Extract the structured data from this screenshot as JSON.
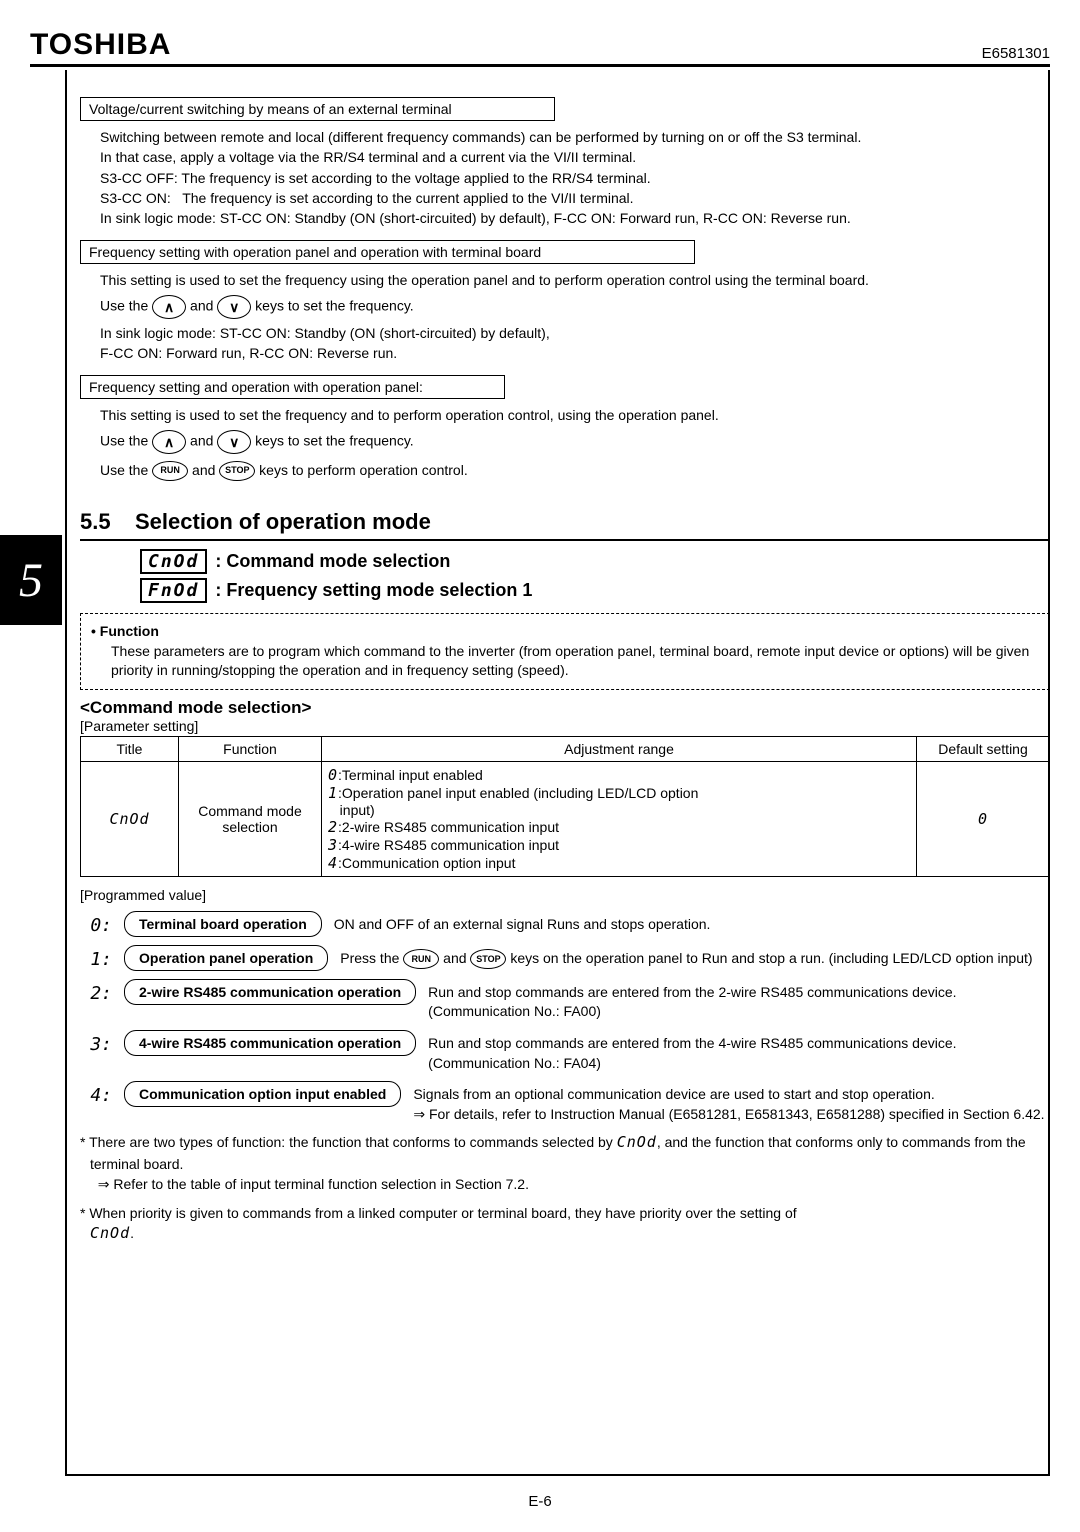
{
  "brand": "TOSHIBA",
  "doc_number": "E6581301",
  "block1": {
    "title": "Voltage/current switching by means of an external terminal",
    "lines": [
      "Switching between remote and local (different frequency commands) can be performed by turning on or off the S3 terminal.",
      "In that case, apply a voltage via the RR/S4 terminal and a current via the VI/II terminal.",
      "S3-CC OFF: The frequency is set according to the voltage applied to the RR/S4 terminal.",
      "S3-CC ON:   The frequency is set according to the current applied to the VI/II terminal.",
      "In sink logic mode: ST-CC ON: Standby (ON (short-circuited) by default), F-CC ON: Forward run, R-CC ON: Reverse run."
    ]
  },
  "block2": {
    "title": "Frequency setting with operation panel and operation with terminal board",
    "lines1": "This setting is used to set the frequency using the operation panel and to perform operation control using the terminal board.",
    "use_the": "Use the",
    "and": "and",
    "keys_freq": "keys to set the frequency.",
    "lines2": "In sink logic mode: ST-CC ON: Standby (ON (short-circuited) by default),",
    "lines3": "F-CC ON: Forward run, R-CC ON: Reverse run."
  },
  "block3": {
    "title": "Frequency setting and operation with operation panel:",
    "line1": "This setting is used to set the frequency and to perform operation control, using the operation panel.",
    "use_the": "Use the",
    "and": "and",
    "keys_freq": "keys to set the frequency.",
    "keys_op": "keys to perform operation control."
  },
  "section": {
    "num": "5.5",
    "title": "Selection of operation mode"
  },
  "chapter_tab": "5",
  "sub": {
    "p1_code": "CnOd",
    "p1_label": ": Command mode selection",
    "p2_code": "FnOd",
    "p2_label": ": Frequency setting mode selection 1"
  },
  "func_box": {
    "heading": "• Function",
    "text": "These parameters are to program which command to the inverter (from operation panel, terminal board, remote input device or options) will be given priority in running/stopping the operation and in frequency setting (speed)."
  },
  "cmd_mode_head": "<Command mode selection>",
  "param_label": "[Parameter setting]",
  "table": {
    "headers": {
      "title": "Title",
      "func": "Function",
      "range": "Adjustment range",
      "def": "Default setting"
    },
    "row": {
      "title": "CnOd",
      "func": "Command mode selection",
      "range_lines": [
        "0:Terminal input enabled",
        "1:Operation panel input enabled (including LED/LCD option input)",
        "2:2-wire RS485 communication input",
        "3:4-wire RS485 communication input",
        "4:Communication option input"
      ],
      "def": "0"
    }
  },
  "prog_label": "[Programmed value]",
  "key_labels": {
    "up": "∧",
    "down": "∨",
    "run": "RUN",
    "stop": "STOP"
  },
  "pv": [
    {
      "num": "0:",
      "pill": "Terminal board operation",
      "text": "ON and OFF of an external signal Runs and stops operation."
    },
    {
      "num": "1:",
      "pill": "Operation panel operation",
      "text_a": "Press the",
      "text_b": "and",
      "text_c": "keys on the operation panel to Run and stop a run. (including LED/LCD option input)"
    },
    {
      "num": "2:",
      "pill": "2-wire RS485 communication operation",
      "text": "Run and stop commands are entered from the 2-wire RS485 communications device. (Communication No.: FA00)"
    },
    {
      "num": "3:",
      "pill": "4-wire RS485 communication operation",
      "text": "Run and stop commands are entered from the 4-wire RS485 communications device. (Communication No.: FA04)"
    },
    {
      "num": "4:",
      "pill": "Communication option input enabled",
      "text": "Signals from an optional communication device are used to start and stop operation.",
      "arrow": "⇒ For details, refer to Instruction Manual (E6581281, E6581343, E6581288) specified in Section 6.42."
    }
  ],
  "notes": {
    "n1a": "* There are two types of function: the function that conforms to commands selected by ",
    "n1b": ", and the function that conforms only to commands from the terminal board.",
    "n1_arrow": "⇒ Refer to the table of input terminal function selection in Section 7.2.",
    "n2a": "* When priority is given to commands from a linked computer or terminal board, they have priority over the setting of ",
    "n2b": "."
  },
  "footer": "E-6"
}
